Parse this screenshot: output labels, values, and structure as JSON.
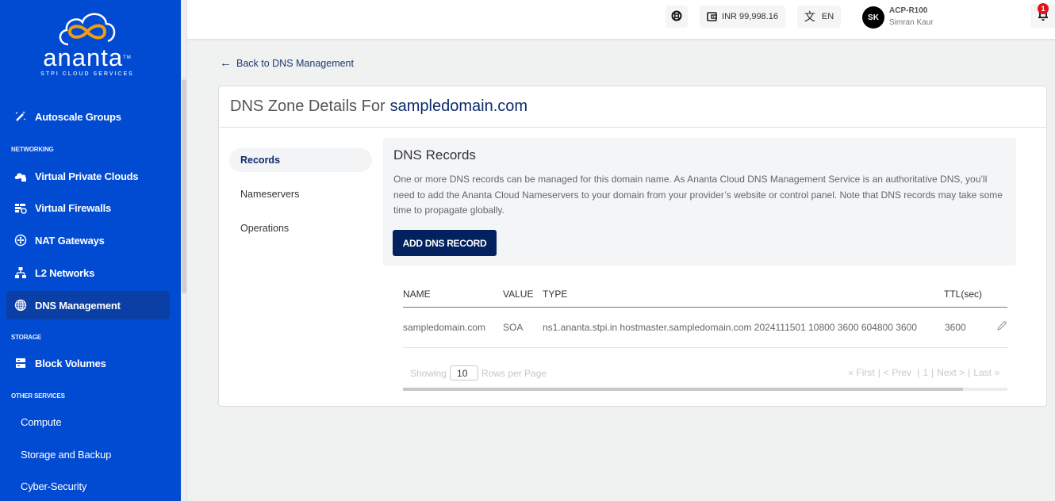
{
  "brand": {
    "name": "ananta",
    "tm": "TM",
    "tagline": "STPI CLOUD SERVICES",
    "colors": {
      "sidebar": "#014bd2",
      "active_item": "#0a3fa5",
      "logo_orange": "#f39c12",
      "primary_button": "#04215f"
    }
  },
  "sidebar": {
    "items": [
      {
        "label": "Autoscale Groups",
        "icon": "magic-wand-icon"
      },
      {
        "section": "NETWORKING"
      },
      {
        "label": "Virtual Private Clouds",
        "icon": "cloud-lock-icon"
      },
      {
        "label": "Virtual Firewalls",
        "icon": "firewall-icon"
      },
      {
        "label": "NAT Gateways",
        "icon": "nat-gateway-icon"
      },
      {
        "label": "L2 Networks",
        "icon": "network-hierarchy-icon"
      },
      {
        "label": "DNS Management",
        "icon": "globe-icon",
        "active": true
      },
      {
        "section": "STORAGE"
      },
      {
        "label": "Block Volumes",
        "icon": "server-icon"
      },
      {
        "section": "OTHER SERVICES"
      },
      {
        "label": "Compute"
      },
      {
        "label": "Storage and Backup"
      },
      {
        "label": "Cyber-Security"
      }
    ]
  },
  "header": {
    "support_icon": "lifebuoy-icon",
    "wallet_balance": "INR 99,998.16",
    "language": "EN",
    "user": {
      "initials": "SK",
      "account": "ACP-R100",
      "name": "Simran Kaur"
    },
    "notifications_count": "1"
  },
  "page": {
    "back_link": "Back to DNS Management",
    "title_prefix": "DNS Zone Details For",
    "domain": "sampledomain.com",
    "tabs": [
      {
        "label": "Records",
        "active": true
      },
      {
        "label": "Nameservers"
      },
      {
        "label": "Operations"
      }
    ],
    "records_section": {
      "title": "DNS Records",
      "description": "One or more DNS records can be managed for this domain name. As Ananta Cloud DNS Management Service is an authoritative DNS, you’ll need to add the Ananta Cloud Nameservers to your domain from your provider’s website or control panel. Note that DNS records may take some time to propagate globally.",
      "add_button": "ADD DNS RECORD"
    },
    "table": {
      "columns": [
        "NAME",
        "VALUE",
        "TYPE",
        "TTL(sec)"
      ],
      "rows": [
        {
          "name": "sampledomain.com",
          "value": "SOA",
          "type": "ns1.ananta.stpi.in hostmaster.sampledomain.com 2024111501 10800 3600 604800 3600",
          "ttl": "3600"
        }
      ]
    },
    "pagination": {
      "showing_label": "Showing",
      "rows_per_page": "10",
      "rows_label": "Rows per Page",
      "first": "« First",
      "prev": "< Prev",
      "current": "1",
      "next": "Next >",
      "last": "Last »"
    }
  }
}
